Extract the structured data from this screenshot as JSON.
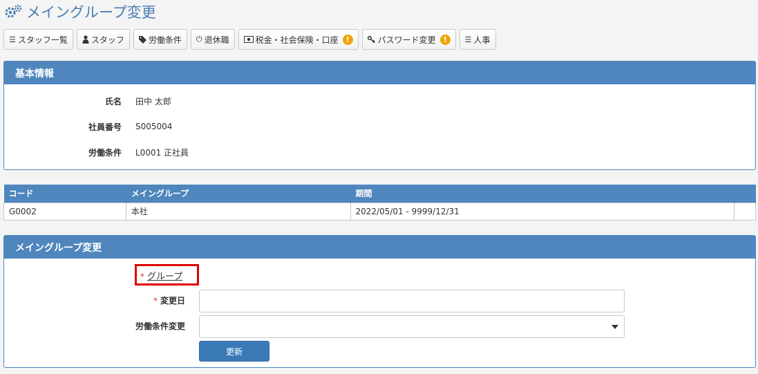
{
  "page": {
    "title": "メイングループ変更"
  },
  "toolbar": {
    "buttons": [
      {
        "label": "スタッフ一覧",
        "icon": "list-icon",
        "warning": false
      },
      {
        "label": "スタッフ",
        "icon": "user-icon",
        "warning": false
      },
      {
        "label": "労働条件",
        "icon": "tag-icon",
        "warning": false
      },
      {
        "label": "退休職",
        "icon": "power-icon",
        "warning": false
      },
      {
        "label": "税金・社会保険・口座",
        "icon": "money-icon",
        "warning": true
      },
      {
        "label": "パスワード変更",
        "icon": "key-icon",
        "warning": true
      },
      {
        "label": "人事",
        "icon": "list-alt-icon",
        "warning": false
      }
    ],
    "warning_glyph": "!"
  },
  "basic_info": {
    "heading": "基本情報",
    "rows": [
      {
        "label": "氏名",
        "value": "田中 太郎"
      },
      {
        "label": "社員番号",
        "value": "S005004"
      },
      {
        "label": "労働条件",
        "value": "L0001 正社員"
      }
    ]
  },
  "group_table": {
    "columns": [
      "コード",
      "メイングループ",
      "期間",
      ""
    ],
    "rows": [
      [
        "G0002",
        "本社",
        "2022/05/01 - 9999/12/31",
        ""
      ]
    ]
  },
  "change_form": {
    "heading": "メイングループ変更",
    "required_mark": "*",
    "group_label": "グループ",
    "date_label": "変更日",
    "date_value": "",
    "labor_label": "労働条件変更",
    "labor_selected": "",
    "submit_label": "更新"
  },
  "colors": {
    "accent": "#4e86bd",
    "title": "#4a7db5",
    "warning": "#f0a30a",
    "required": "#d9342b",
    "highlight": "#e00000",
    "button_primary": "#3a7ab7"
  }
}
